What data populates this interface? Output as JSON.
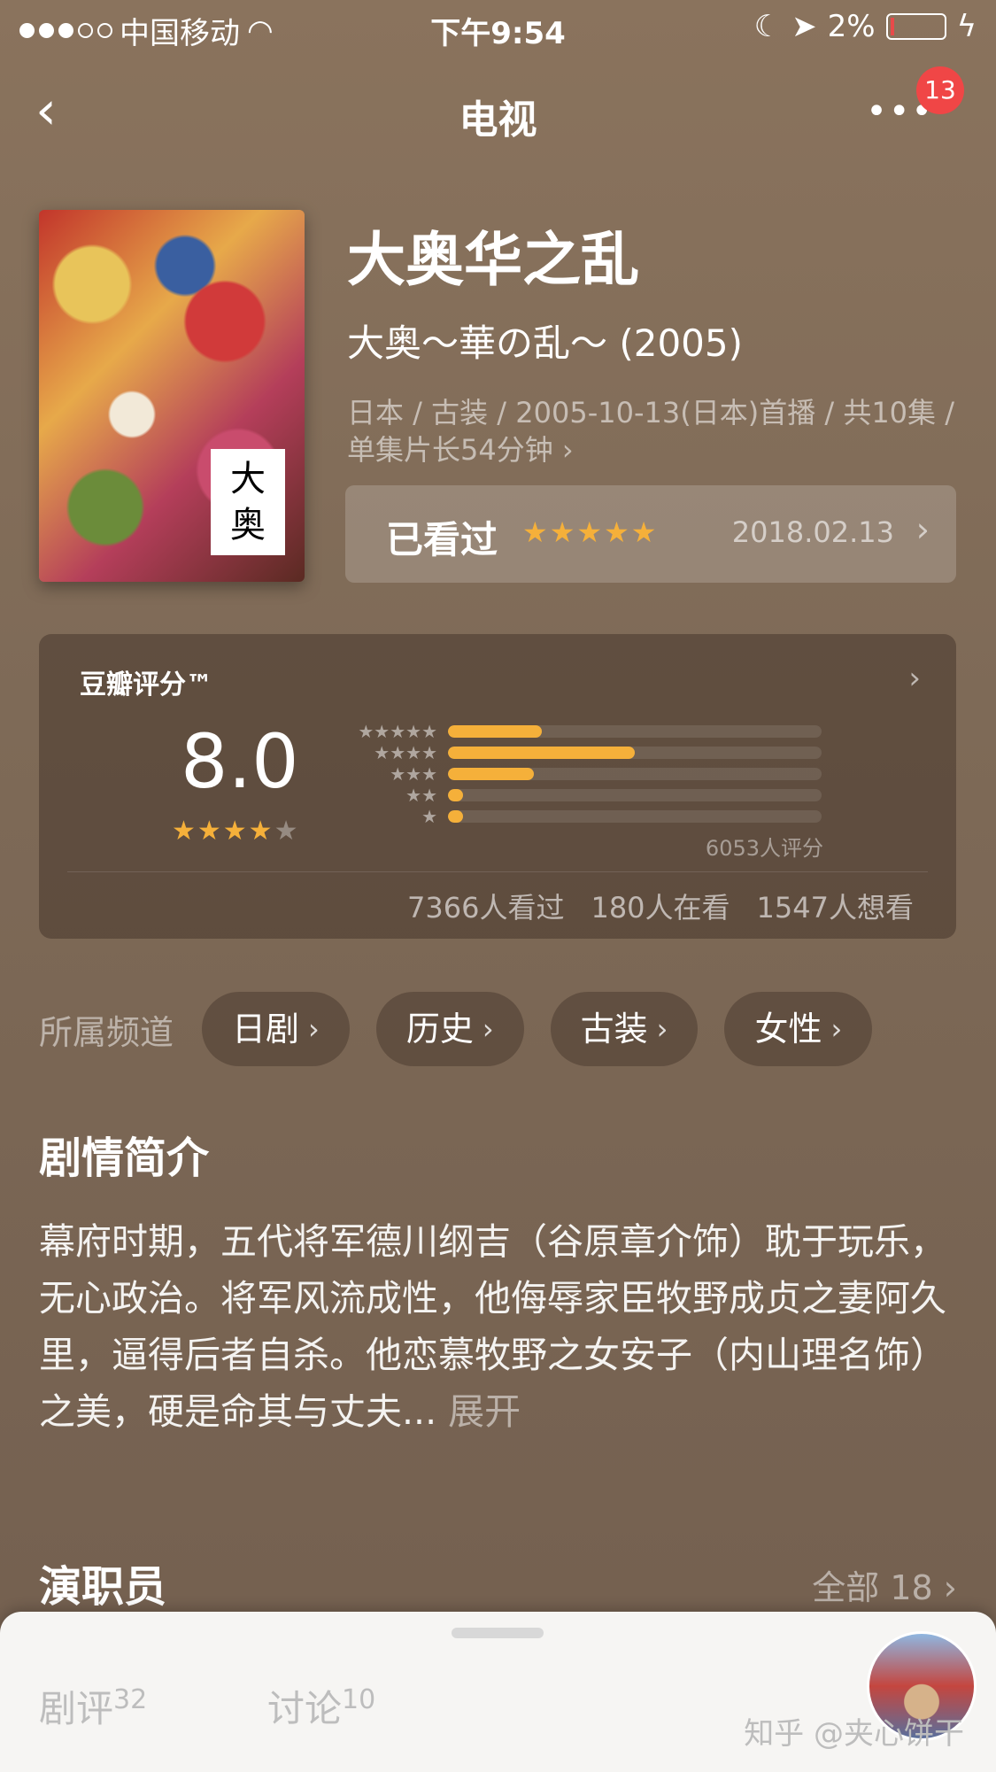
{
  "status_bar": {
    "carrier": "中国移动",
    "time": "下午9:54",
    "battery": "2%"
  },
  "nav": {
    "title": "电视",
    "badge_count": "13"
  },
  "title": {
    "name": "大奥华之乱",
    "original": "大奥～華の乱～ (2005)",
    "meta": "日本 / 古装 / 2005-10-13(日本)首播 / 共10集 / 单集片长54分钟",
    "meta_chevron": "›"
  },
  "watched": {
    "label": "已看过",
    "stars": "★★★★★",
    "user_rating": 5,
    "date": "2018.02.13"
  },
  "rating": {
    "brand": "豆瓣评分™",
    "score": "8.0",
    "stars_on": "★★★★",
    "stars_off": "★",
    "distribution": [
      {
        "stars": "★★★★★",
        "fraction": 0.25
      },
      {
        "stars": "★★★★",
        "fraction": 0.5
      },
      {
        "stars": "★★★",
        "fraction": 0.23
      },
      {
        "stars": "★★",
        "fraction": 0.04
      },
      {
        "stars": "★",
        "fraction": 0.04
      }
    ],
    "count": "6053人评分",
    "watched": "7366人看过",
    "watching": "180人在看",
    "want": "1547人想看"
  },
  "channels": {
    "label": "所属频道",
    "items": [
      "日剧",
      "历史",
      "古装",
      "女性"
    ]
  },
  "synopsis": {
    "title": "剧情简介",
    "text": "幕府时期，五代将军德川纲吉（谷原章介饰）耽于玩乐，无心政治。将军风流成性，他侮辱家臣牧野成贞之妻阿久里，逼得后者自杀。他恋慕牧野之女安子（内山理名饰）之美，硬是命其与丈夫...",
    "expand": "展开"
  },
  "cast": {
    "title": "演职员",
    "all": "全部 18"
  },
  "bottom": {
    "reviews_label": "剧评",
    "reviews_count": "32",
    "discussion_label": "讨论",
    "discussion_count": "10",
    "watermark": "知乎 @夹心饼干"
  },
  "colors": {
    "accent": "#f5b03a",
    "badge": "#f04646"
  }
}
